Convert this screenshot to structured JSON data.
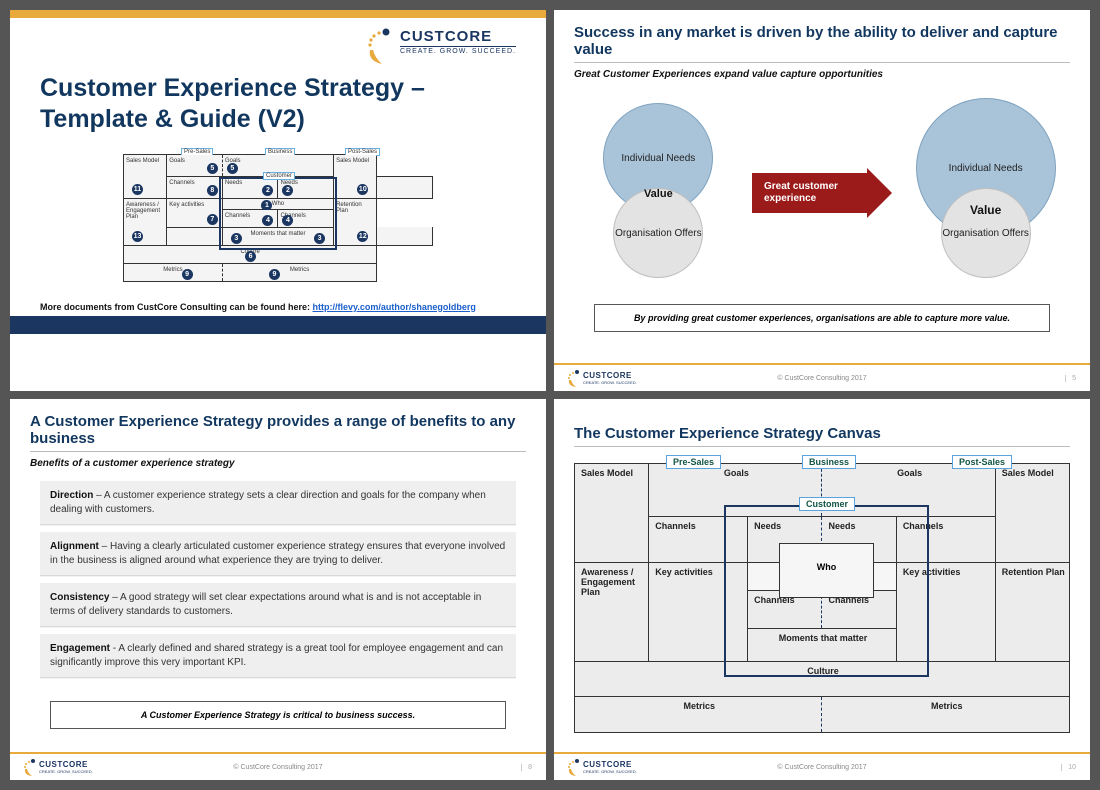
{
  "brand": {
    "name": "CUSTCORE",
    "tagline": "CREATE. GROW. SUCCEED."
  },
  "slide1": {
    "title": "Customer Experience Strategy – Template & Guide (V2)",
    "more_docs": "More documents from CustCore Consulting can be found here:",
    "link_text": "http://flevy.com/author/shanegoldberg",
    "mini": {
      "tag_pre": "Pre-Sales",
      "tag_bus": "Business",
      "tag_post": "Post-Sales",
      "tag_cust": "Customer",
      "sales_model": "Sales Model",
      "goals": "Goals",
      "channels": "Channels",
      "needs": "Needs",
      "who": "Who",
      "key_act": "Key activities",
      "moments": "Moments that matter",
      "aware": "Awareness / Engagement Plan",
      "retention": "Retention Plan",
      "culture": "Culture",
      "metrics": "Metrics"
    }
  },
  "slide2": {
    "title": "Success in any market is driven by the ability to deliver and capture value",
    "subtitle": "Great Customer Experiences expand value capture opportunities",
    "venn_top": "Individual Needs",
    "venn_value": "Value",
    "venn_bot": "Organisation Offers",
    "arrow": "Great customer experience",
    "note": "By providing great customer experiences, organisations are able to capture more value.",
    "copy": "© CustCore Consulting 2017",
    "page": "5"
  },
  "slide3": {
    "title": "A Customer Experience Strategy provides a range of benefits to any business",
    "subtitle": "Benefits of a customer experience strategy",
    "b1_h": "Direction",
    "b1": " – A customer experience strategy sets a clear direction and goals for the company when dealing with customers.",
    "b2_h": "Alignment",
    "b2": " – Having a clearly articulated customer experience strategy ensures that everyone involved in the business is aligned around what experience they are trying to deliver.",
    "b3_h": "Consistency",
    "b3": " – A good strategy will set clear expectations around what is and is not acceptable in terms of delivery standards to customers.",
    "b4_h": "Engagement",
    "b4": " -  A clearly defined and shared strategy is a great tool for employee engagement and can significantly improve this very important KPI.",
    "note": "A Customer Experience Strategy is critical to business success.",
    "copy": "© CustCore Consulting 2017",
    "page": "8"
  },
  "slide4": {
    "title": "The Customer Experience Strategy Canvas",
    "tag_pre": "Pre-Sales",
    "tag_bus": "Business",
    "tag_post": "Post-Sales",
    "tag_cust": "Customer",
    "sales_model": "Sales Model",
    "goals": "Goals",
    "channels": "Channels",
    "needs": "Needs",
    "who": "Who",
    "key_act": "Key activities",
    "moments": "Moments   that   matter",
    "aware": "Awareness / Engagement Plan",
    "retention": "Retention Plan",
    "culture": "Culture",
    "metrics": "Metrics",
    "copy": "© CustCore Consulting 2017",
    "page": "10"
  }
}
